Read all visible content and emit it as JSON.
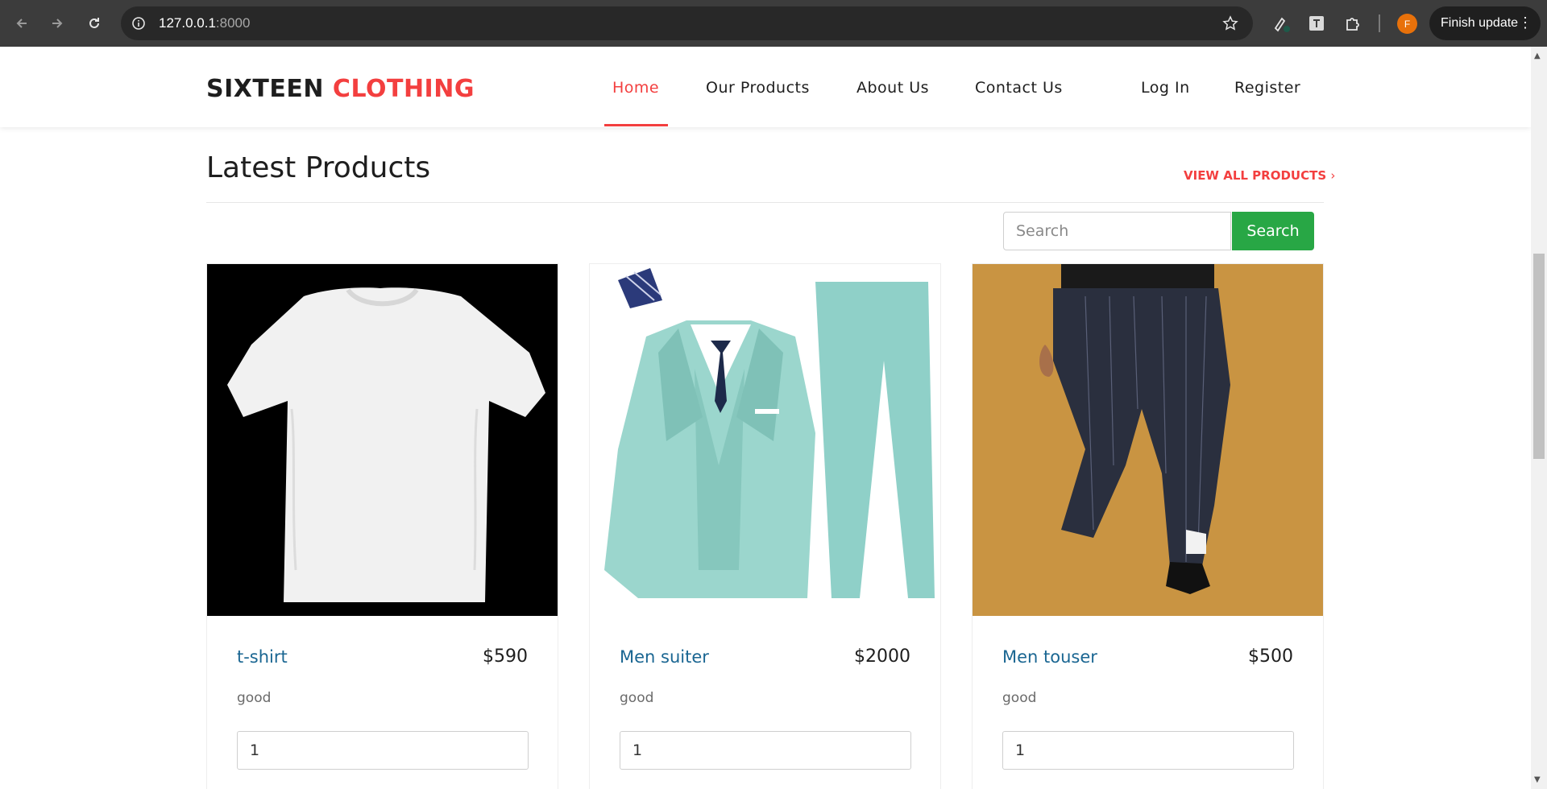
{
  "browser": {
    "url_host": "127.0.0.1",
    "url_port": ":8000",
    "profile_initial": "F",
    "update_label": "Finish update",
    "icons": [
      "back-arrow-icon",
      "forward-arrow-icon",
      "reload-icon",
      "site-info-icon",
      "bookmark-star-icon",
      "extension-icon",
      "translate-icon",
      "puzzle-icon",
      "more-vert-icon"
    ]
  },
  "header": {
    "logo_main": "SIXTEEN",
    "logo_accent": "CLOTHING",
    "menu": [
      {
        "label": "Home",
        "active": true
      },
      {
        "label": "Our Products"
      },
      {
        "label": "About Us"
      },
      {
        "label": "Contact Us"
      },
      {
        "label": "Log In"
      },
      {
        "label": "Register"
      }
    ]
  },
  "section": {
    "title": "Latest Products",
    "view_all": "VIEW ALL PRODUCTS",
    "view_all_icon": "chevron-right-icon"
  },
  "search": {
    "placeholder": "Search",
    "button": "Search"
  },
  "products": [
    {
      "name": "t-shirt",
      "price": "$590",
      "description": "good",
      "quantity": "1",
      "image": "white-tshirt"
    },
    {
      "name": "Men suiter",
      "price": "$2000",
      "description": "good",
      "quantity": "1",
      "image": "mint-suit"
    },
    {
      "name": "Men touser",
      "price": "$500",
      "description": "good",
      "quantity": "1",
      "image": "striped-trousers"
    }
  ],
  "colors": {
    "accent": "#f33f3f",
    "product_name": "#1a6692",
    "search_button": "#28a745",
    "chrome_bg": "#3c3c3c"
  }
}
